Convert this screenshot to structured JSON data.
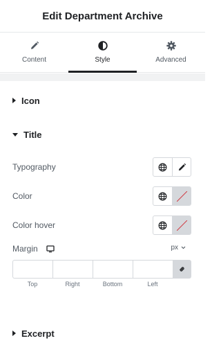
{
  "header": {
    "title": "Edit Department Archive"
  },
  "tabs": [
    {
      "label": "Content",
      "icon": "pencil-icon"
    },
    {
      "label": "Style",
      "icon": "half-circle-icon",
      "active": true
    },
    {
      "label": "Advanced",
      "icon": "gear-icon"
    }
  ],
  "sections": {
    "icon": {
      "label": "Icon",
      "expanded": false
    },
    "title": {
      "label": "Title",
      "expanded": true
    },
    "excerpt": {
      "label": "Excerpt",
      "expanded": false
    }
  },
  "title_controls": {
    "typography_label": "Typography",
    "color_label": "Color",
    "color_hover_label": "Color hover",
    "margin_label": "Margin",
    "unit": "px",
    "dims": [
      "Top",
      "Right",
      "Bottom",
      "Left"
    ]
  },
  "colors": {
    "text": "#1f2124",
    "muted": "#515962",
    "border": "#d5d8dc",
    "bar": "#f1f2f3",
    "unset_slash": "#d0373f"
  }
}
